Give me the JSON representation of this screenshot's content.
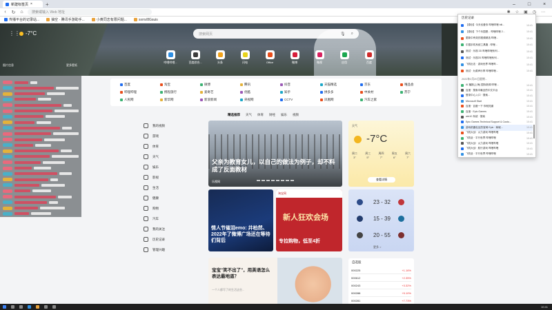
{
  "browser": {
    "tab_title": "新建标签页",
    "url": "搜索或输入 Web 地址",
    "bookmarks": [
      "传播平台的记录站...",
      "抽空 · 腾讯手游助手...",
      "小黄同志有限问题...",
      "sxrrs/8Gsuis"
    ]
  },
  "hero": {
    "temperature": "-7°C",
    "search_placeholder": "搜索网页",
    "apps": [
      {
        "label": "哔哩哔哩...",
        "color": "#2f8fe3"
      },
      {
        "label": "百度综合...",
        "color": "#3c3c3c"
      },
      {
        "label": "头条",
        "color": "#f2a31b"
      },
      {
        "label": "闪电",
        "color": "#e8d31c"
      },
      {
        "label": "Office",
        "color": "#e94e1b"
      },
      {
        "label": "微博",
        "color": "#d81e3b"
      },
      {
        "label": "微视",
        "color": "#d8205f"
      },
      {
        "label": "应用",
        "color": "#1aa74f"
      },
      {
        "label": "百度",
        "color": "#cf2a2a"
      }
    ],
    "left_caption": "图片信息",
    "right_caption": "更多壁纸"
  },
  "quick_links": [
    [
      "百度",
      "淘宝",
      "微博",
      "腾讯",
      "抖音",
      "天猫精选",
      "京东",
      "唯品会"
    ],
    [
      "哔哩哔哩",
      "携程旅行",
      "爱奇艺",
      "优酷",
      "知乎",
      "拼多多",
      "中关村",
      "苏宁"
    ],
    [
      "人民网",
      "新华网",
      "新浪新闻",
      "央视网",
      "CCTV",
      "凤凰网",
      "汽车之家",
      ""
    ]
  ],
  "news_tabs": [
    "精选推荐",
    "天气",
    "体育",
    "财经",
    "娱乐",
    "视频"
  ],
  "nav": [
    "我的视频",
    "游戏",
    "体育",
    "天气",
    "娱乐",
    "影视",
    "生活",
    "健康",
    "购物",
    "汽车",
    "我的关注",
    "历史记录",
    "管理兴趣"
  ],
  "main_card": {
    "headline": "父亲为教育女儿，以自己的做法为例子，却不料成了反面教材",
    "source": "乐视网"
  },
  "card2": {
    "headline": "情人节催泪emo: 井柏然、2022年了微博广场还在等待们背后"
  },
  "card3": {
    "big": "新人狂欢会场",
    "top": "淘宝网",
    "headline": "专拉购物，低至4折"
  },
  "card4": {
    "headline": "宝宝\"笑不出了\"，用英语怎么表达最地道？",
    "meta": "一个人都写了的生活这些..."
  },
  "weather": {
    "title": "天气",
    "temp": "-7°C",
    "days": [
      "周二",
      "周三",
      "周四",
      "周五",
      "周六"
    ],
    "lows": [
      "3°",
      "5°",
      "7°",
      "6°",
      "7°"
    ],
    "button": "查看详情"
  },
  "sports": {
    "scores": [
      "23 - 32",
      "15 - 39",
      "20 - 55"
    ],
    "button": "更多 >"
  },
  "finance": {
    "title": "自选股",
    "rows": [
      [
        "000225",
        "+1.16%"
      ],
      [
        "000612",
        "+2.35%"
      ],
      [
        "000243",
        "+3.32%"
      ],
      [
        "000288",
        "+5.10%"
      ],
      [
        "000281",
        "+7.73%"
      ]
    ]
  },
  "history_popup": {
    "title": "历史记录",
    "section": "2022年2月20日星期...",
    "rows": [
      "【原创】今天也爱你 哔哩哔哩 bili...",
      "【原创】下个乐园是... 哔哩哔哩 2...",
      "更新中有效的视频精选 哔哩...",
      "中国手机系统工具箱 - 哔哩...",
      "测试 · 乐视 2D 哔哩哔哩系列...",
      "测试 · 乐视2D 哔哩哔哩系列...",
      "飞机出击 · 游戏世界 哔哩哔...",
      "测试 · 为原声乐享 哔哩哔哩...",
      "AI 播报(上海) 国际新闻 哔哩...",
      "百度 · 搜索中最全的中文平台",
      "登录中心入口 · 搜索...",
      "Microsoft Start",
      "百度 · 百度一下 你就知道",
      "百度 · Epic Games",
      "win10 系统 · 搜索",
      "Epic Games Technical Support & Custo...",
      "游戏机器社区的官网 Epic · 商城...",
      "飞机大战 · 火力游戏 哔哩哔哩",
      "飞机全 · 平行世界 哔哩哔哩",
      "飞机大战 · 火力游戏 哔哩哔哩",
      "飞机大战 · 航行游戏 哔哩哔哩",
      "飞机全 · 平行世界 哔哩哔哩"
    ],
    "time": "10:41"
  },
  "taskbar": {
    "clock": "10:41"
  }
}
